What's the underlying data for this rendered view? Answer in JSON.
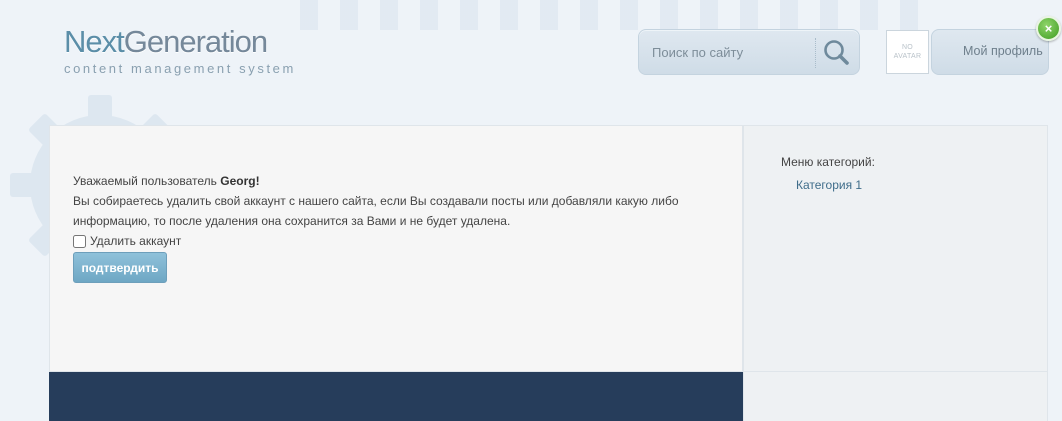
{
  "logo": {
    "next": "Next",
    "generation": "Generation",
    "subtitle": "content management system"
  },
  "search": {
    "placeholder": "Поиск по сайту",
    "icon": "search-icon"
  },
  "avatar": {
    "line1": "NO",
    "line2": "AVATAR"
  },
  "profile": {
    "label": "Мой профиль"
  },
  "close": {
    "label": "×",
    "icon": "close-icon",
    "color": "#4aa82c"
  },
  "main": {
    "greeting_prefix": "Уважаемый пользователь ",
    "username": "Georg!",
    "message": "Вы собираетесь удалить свой аккаунт с нашего сайта, если Вы создавали посты или добавляли какую либо информацию, то после удаления она сохранится за Вами и не будет удалена.",
    "checkbox_label": "Удалить аккаунт",
    "checkbox_checked": false,
    "confirm_label": "подтвердить"
  },
  "sidebar": {
    "title": "Меню категорий:",
    "items": [
      {
        "label": "Категория 1"
      }
    ]
  },
  "colors": {
    "accent": "#6ea7c4",
    "footer": "#263d5b",
    "link": "#3f6d8a"
  }
}
